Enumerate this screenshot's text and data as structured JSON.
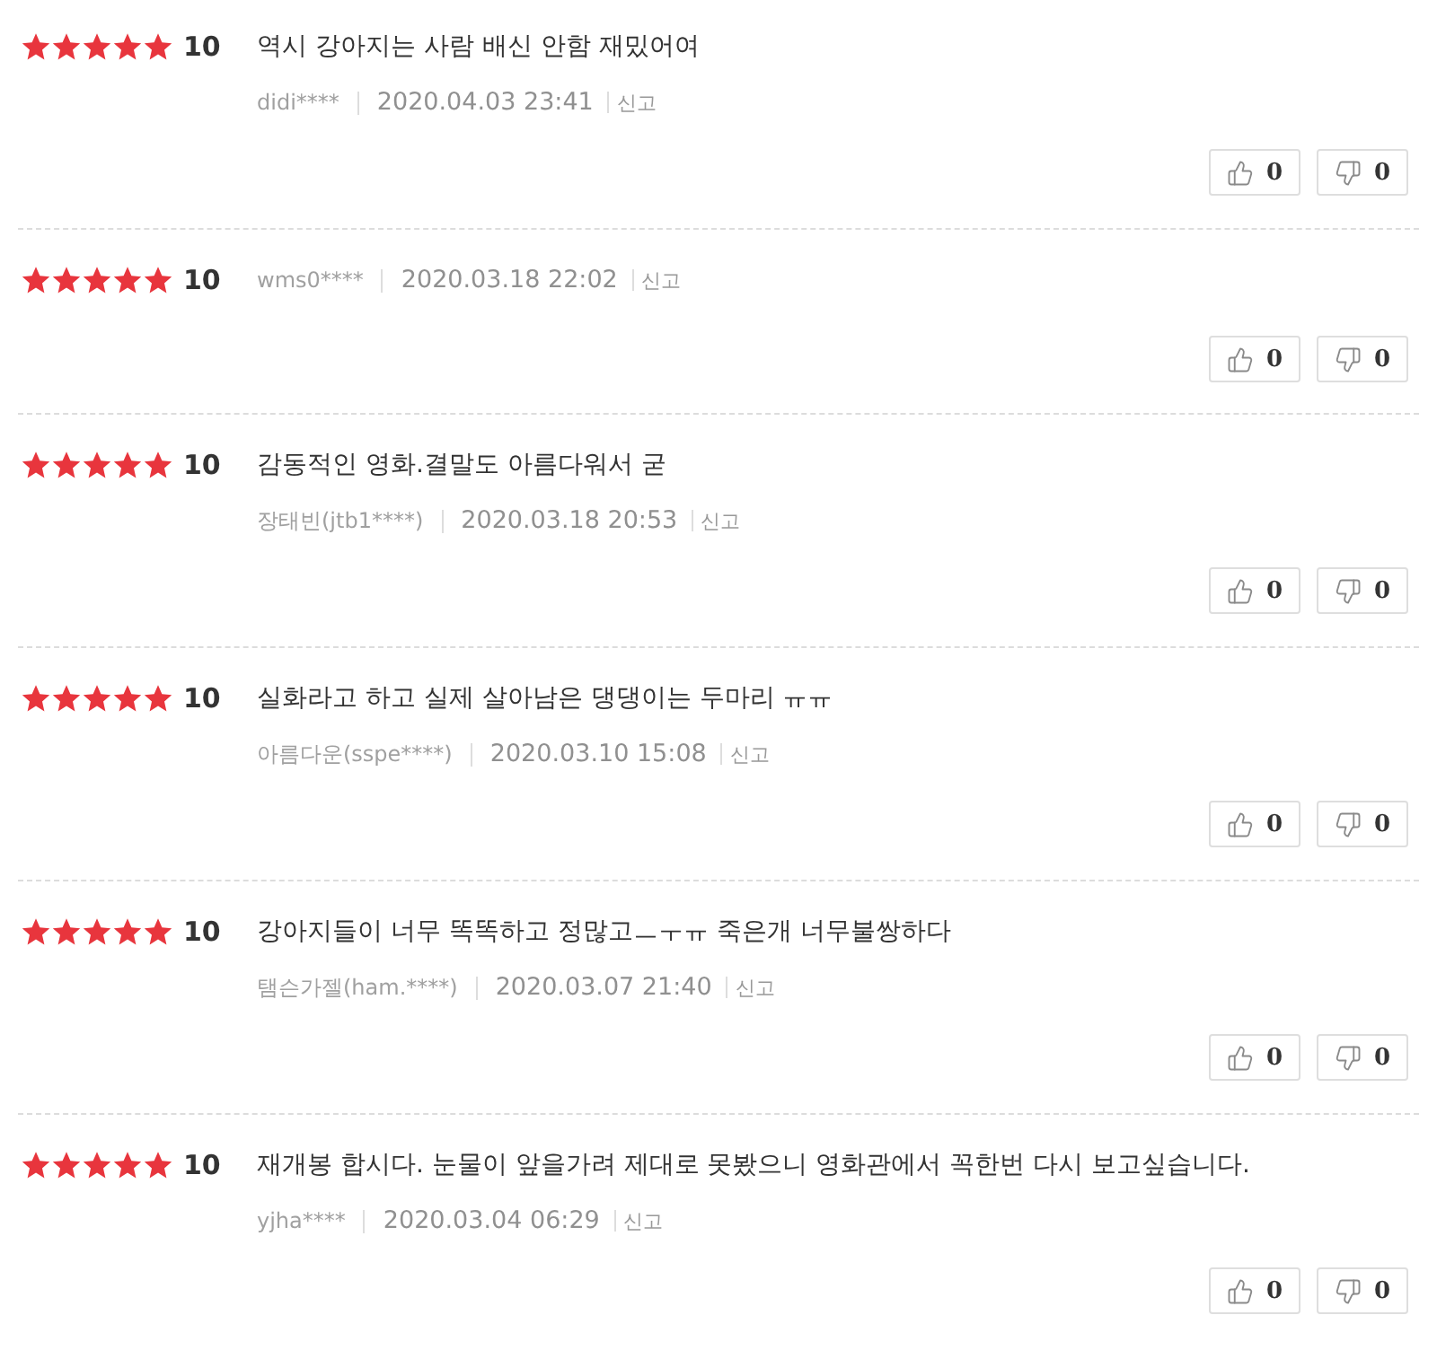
{
  "reviews": [
    {
      "stars": 5,
      "score": "10",
      "comment": "역시 강아지는 사람 배신 안함 재밌어여",
      "author": "didi****",
      "date": "2020.04.03 23:41",
      "report": "신고",
      "likes": "0",
      "dislikes": "0"
    },
    {
      "stars": 5,
      "score": "10",
      "author": "wms0****",
      "date": "2020.03.18 22:02",
      "report": "신고",
      "likes": "0",
      "dislikes": "0"
    },
    {
      "stars": 5,
      "score": "10",
      "comment": "감동적인 영화.결말도 아름다워서 굳",
      "author": "장태빈(jtb1****)",
      "date": "2020.03.18 20:53",
      "report": "신고",
      "likes": "0",
      "dislikes": "0"
    },
    {
      "stars": 5,
      "score": "10",
      "comment": "실화라고 하고 실제 살아남은 댕댕이는 두마리 ㅠㅠ",
      "author": "아름다운(sspe****)",
      "date": "2020.03.10 15:08",
      "report": "신고",
      "likes": "0",
      "dislikes": "0"
    },
    {
      "stars": 5,
      "score": "10",
      "comment": "강아지들이 너무 똑똑하고 정많고ㅡㅜㅠ 죽은개 너무불쌍하다",
      "author": "탬슨가젤(ham.****)",
      "date": "2020.03.07 21:40",
      "report": "신고",
      "likes": "0",
      "dislikes": "0"
    },
    {
      "stars": 5,
      "score": "10",
      "comment": "재개봉 합시다. 눈물이 앞을가려 제대로 못봤으니 영화관에서 꼭한번 다시 보고싶습니다.",
      "author": "yjha****",
      "date": "2020.03.04 06:29",
      "report": "신고",
      "likes": "0",
      "dislikes": "0"
    }
  ]
}
